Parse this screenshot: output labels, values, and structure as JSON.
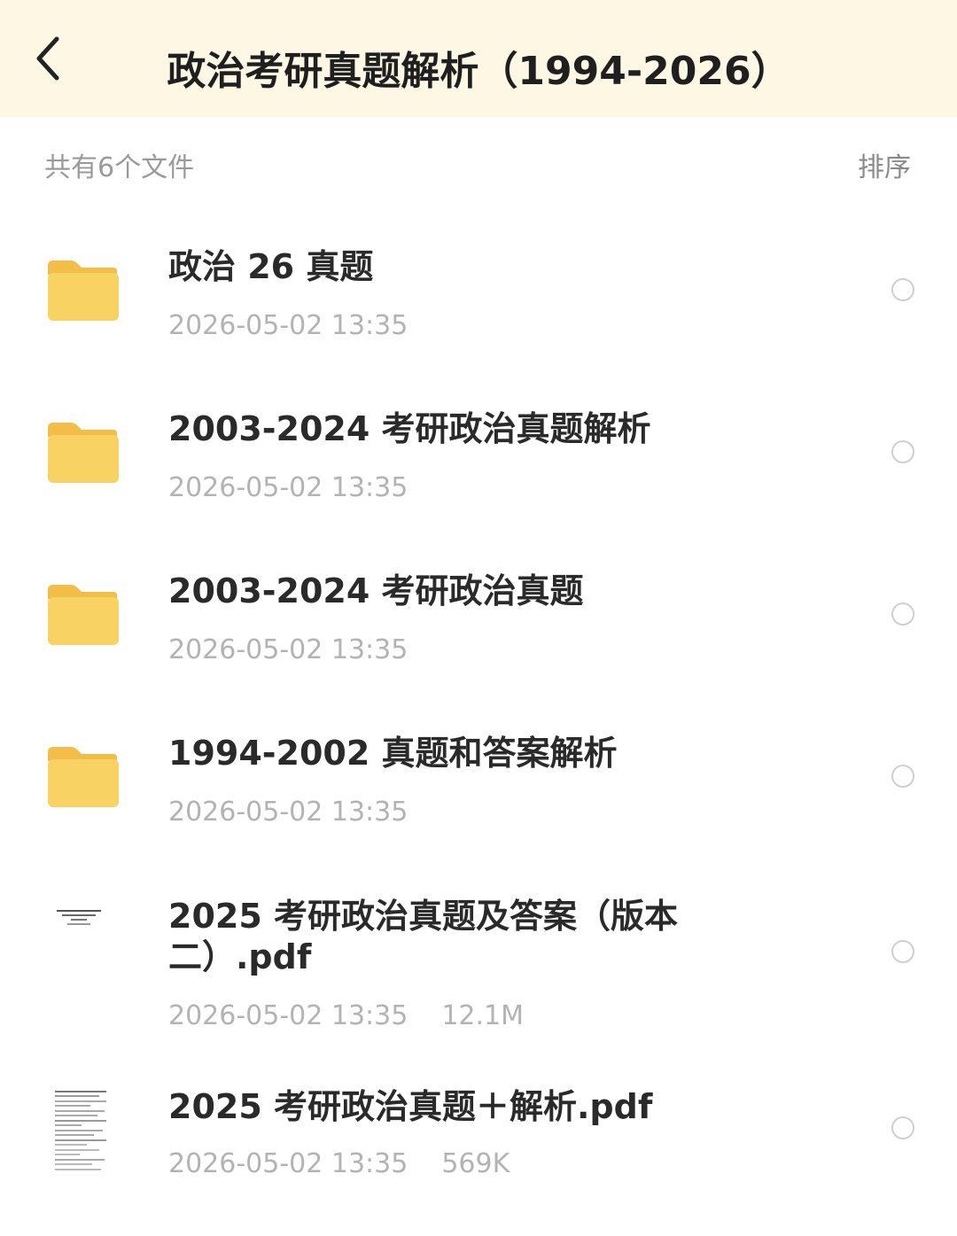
{
  "header": {
    "title": "政治考研真题解析（1994-2026）"
  },
  "subbar": {
    "count_text": "共有6个文件",
    "sort_label": "排序"
  },
  "files": [
    {
      "name": "政治 26 真题",
      "date": "2026-05-02 13:35",
      "size": "",
      "type": "folder"
    },
    {
      "name": "2003-2024 考研政治真题解析",
      "date": "2026-05-02 13:35",
      "size": "",
      "type": "folder"
    },
    {
      "name": "2003-2024 考研政治真题",
      "date": "2026-05-02 13:35",
      "size": "",
      "type": "folder"
    },
    {
      "name": "1994-2002 真题和答案解析",
      "date": "2026-05-02 13:35",
      "size": "",
      "type": "folder"
    },
    {
      "name": "2025 考研政治真题及答案（版本二）.pdf",
      "date": "2026-05-02 13:35",
      "size": "12.1M",
      "type": "pdf"
    },
    {
      "name": "2025 考研政治真题＋解析.pdf",
      "date": "2026-05-02 13:35",
      "size": "569K",
      "type": "pdf"
    }
  ],
  "colors": {
    "header_bg": "#fdf7e4",
    "folder": "#f7cf5d",
    "muted_text": "#b3b3b3"
  }
}
